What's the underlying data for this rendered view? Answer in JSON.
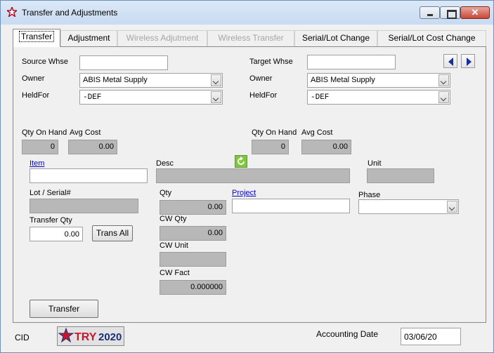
{
  "window": {
    "title": "Transfer and Adjustments",
    "icon": "red-star-icon",
    "controls": {
      "minimize": "minimize-icon",
      "maximize": "maximize-icon",
      "close_glyph": "✕"
    }
  },
  "tabs": [
    {
      "label": "Transfer",
      "state": "active"
    },
    {
      "label": "Adjustment",
      "state": "enabled"
    },
    {
      "label": "Wireless Adjutment",
      "state": "disabled"
    },
    {
      "label": "Wireless Transfer",
      "state": "disabled"
    },
    {
      "label": "Serial/Lot Change",
      "state": "enabled"
    },
    {
      "label": "Serial/Lot Cost Change",
      "state": "enabled"
    }
  ],
  "source": {
    "whse_label": "Source Whse",
    "whse_value": "",
    "owner_label": "Owner",
    "owner_value": "ABIS Metal Supply",
    "heldfor_label": "HeldFor",
    "heldfor_value": "-DEF",
    "qty_on_hand_label": "Qty On Hand",
    "qty_on_hand": "0",
    "avg_cost_label": "Avg Cost",
    "avg_cost": "0.00"
  },
  "target": {
    "whse_label": "Target Whse",
    "whse_value": "",
    "owner_label": "Owner",
    "owner_value": "ABIS Metal Supply",
    "heldfor_label": "HeldFor",
    "heldfor_value": "-DEF",
    "qty_on_hand_label": "Qty On Hand",
    "qty_on_hand": "0",
    "avg_cost_label": "Avg Cost",
    "avg_cost": "0.00"
  },
  "item": {
    "item_link": "Item",
    "item_value": "",
    "desc_label": "Desc",
    "desc_value": "",
    "unit_label": "Unit",
    "unit_value": "",
    "lot_label": "Lot / Serial#",
    "lot_value": "",
    "qty_label": "Qty",
    "qty_value": "0.00",
    "project_link": "Project",
    "project_value": "",
    "phase_label": "Phase",
    "phase_value": "",
    "transfer_qty_label": "Transfer Qty",
    "transfer_qty_value": "0.00",
    "trans_all_button": "Trans All",
    "cw_qty_label": "CW Qty",
    "cw_qty_value": "0.00",
    "cw_unit_label": "CW Unit",
    "cw_unit_value": "",
    "cw_fact_label": "CW Fact",
    "cw_fact_value": "0.000000",
    "transfer_button": "Transfer"
  },
  "footer": {
    "cid_label": "CID",
    "logo_text": "TRY2020",
    "accounting_date_label": "Accounting Date",
    "accounting_date_value": "03/06/20"
  }
}
